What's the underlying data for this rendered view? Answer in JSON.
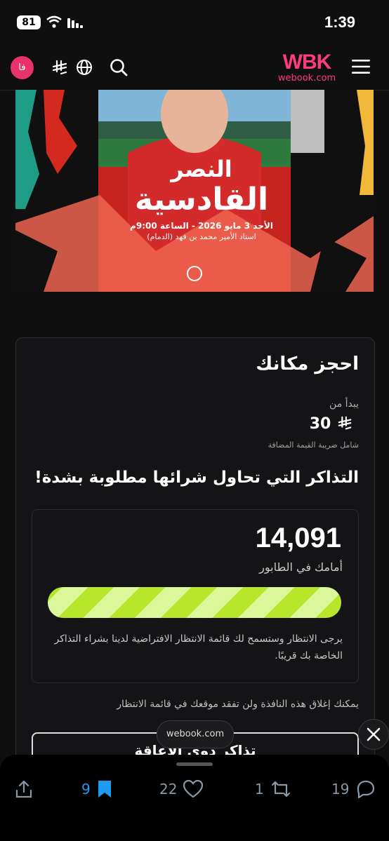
{
  "status_bar": {
    "battery": "81",
    "time": "1:39"
  },
  "nav": {
    "language_badge": "فا",
    "logo_text": "WBK",
    "logo_domain": "webook.com"
  },
  "banner": {
    "title_line1": "النصر",
    "title_line2": "القادسية",
    "date_line": "الأحد 3 مايو 2026 - الساعة 9:00م",
    "venue_line": "استاد الأمير محمد بن فهد (الدمام)"
  },
  "booking": {
    "title": "احجز مكانك",
    "price_label": "يبدأ من",
    "price_value": "30",
    "price_currency": "⃁",
    "vat_note": "شامل ضريبة القيمة المضافة",
    "demand_heading": "التذاكر التي تحاول شرائها مطلوبة بشدة!",
    "queue": {
      "count": "14,091",
      "label": "أمامك في الطابور",
      "progress_percent": 100,
      "message": "يرجى الانتظار وستسمح لك قائمة الانتظار الافتراضية لدينا بشراء التذاكر الخاصة بك قريبًا."
    },
    "close_note": "يمكنك إغلاق هذه النافذة ولن تفقد موقعك في قائمة الانتظار",
    "accessibility_button": "تذاكر ذوي الإعاقة"
  },
  "browser": {
    "url_pill": "webook.com"
  },
  "actions": {
    "bookmarks": "9",
    "likes": "22",
    "reposts": "1",
    "replies": "19"
  },
  "colors": {
    "accent_pink": "#ff3b7f",
    "progress_green": "#b8e62a",
    "bookmark_blue": "#1d9bf0"
  }
}
